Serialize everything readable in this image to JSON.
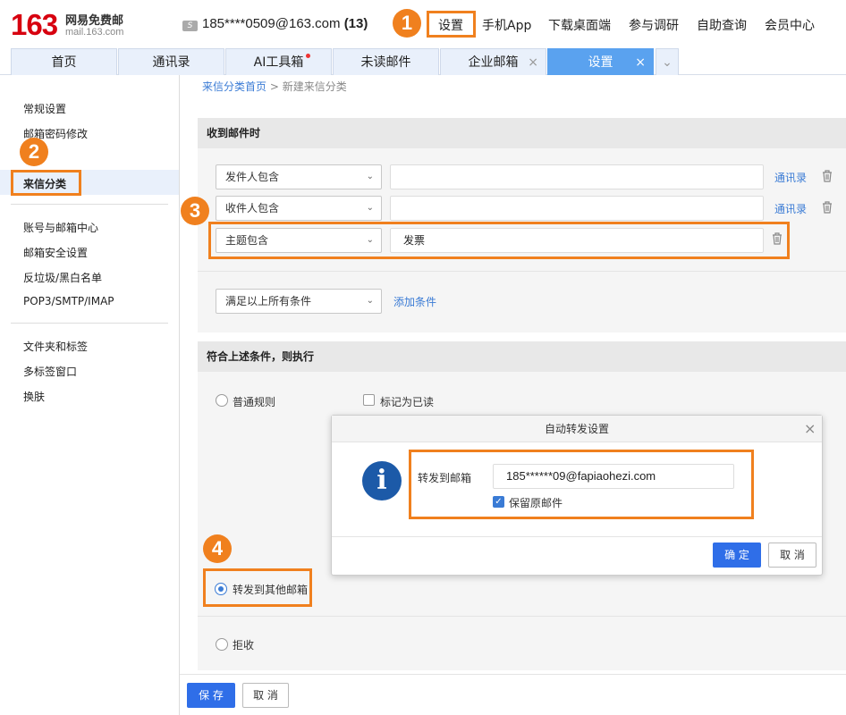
{
  "header": {
    "logo_num": "163",
    "logo_cn": "网易免费邮",
    "logo_en": "mail.163.com",
    "account_icon": "S",
    "account": "185****0509@163.com",
    "unread": "(13)",
    "nav": [
      "设置",
      "手机App",
      "下载桌面端",
      "参与调研",
      "自助查询",
      "会员中心"
    ]
  },
  "tabs": [
    {
      "label": "首页"
    },
    {
      "label": "通讯录"
    },
    {
      "label": "AI工具箱"
    },
    {
      "label": "未读邮件"
    },
    {
      "label": "企业邮箱",
      "close": "×"
    },
    {
      "label": "设置",
      "close": "×"
    }
  ],
  "tab_more": "⌄",
  "sidebar": {
    "group1": [
      "常规设置",
      "邮箱密码修改",
      "来信分类"
    ],
    "group2": [
      "账号与邮箱中心",
      "邮箱安全设置",
      "反垃圾/黑白名单",
      "POP3/SMTP/IMAP"
    ],
    "group3": [
      "文件夹和标签",
      "多标签窗口",
      "换肤"
    ]
  },
  "breadcrumb": {
    "root": "来信分类首页",
    "sep": ">",
    "current": "新建来信分类"
  },
  "receive": {
    "title": "收到邮件时",
    "rows": [
      {
        "field": "发件人包含",
        "value": "",
        "link": "通讯录"
      },
      {
        "field": "收件人包含",
        "value": "",
        "link": "通讯录"
      },
      {
        "field": "主题包含",
        "value": "发票",
        "link": ""
      }
    ],
    "match": "满足以上所有条件",
    "add": "添加条件"
  },
  "execute": {
    "title": "符合上述条件，则执行",
    "normal_rule": "普通规则",
    "mark_read": "标记为已读",
    "forward": "转发到其他邮箱",
    "reject": "拒收"
  },
  "dialog": {
    "title": "自动转发设置",
    "close": "×",
    "info_icon": "i",
    "label": "转发到邮箱",
    "email": "185******09@fapiaohezi.com",
    "keep": "保留原邮件",
    "ok": "确 定",
    "cancel": "取 消"
  },
  "footer": {
    "save": "保 存",
    "cancel": "取 消"
  },
  "badges": [
    "1",
    "2",
    "3",
    "4"
  ],
  "colors": {
    "accent": "#3a7bd5",
    "highlight": "#f0801e",
    "brand": "#d7000f",
    "tab_active": "#5aa2ef"
  }
}
